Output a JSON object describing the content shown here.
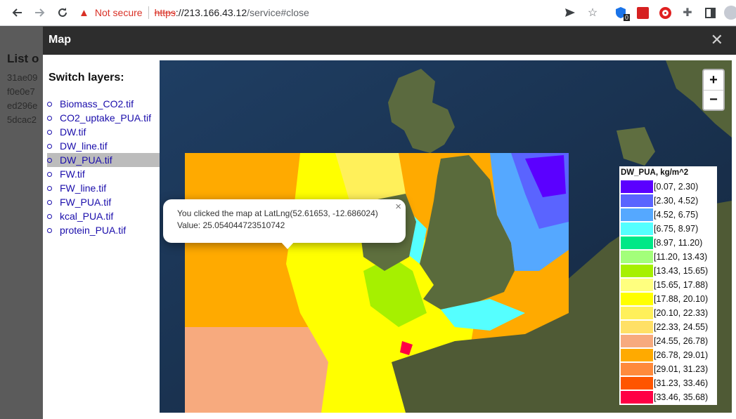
{
  "browser": {
    "warning_text": "Not secure",
    "url_scheme": "https",
    "url_host": "://213.166.43.12",
    "url_path": "/service#close",
    "extension_badge": "0"
  },
  "background_page": {
    "heading": "List o",
    "lines": [
      "31ae09",
      "f0e0e7",
      "ed296e",
      "5dcac2"
    ]
  },
  "modal": {
    "title": "Map",
    "close_glyph": "✕"
  },
  "layers": {
    "title": "Switch layers:",
    "items": [
      "Biomass_CO2.tif",
      "CO2_uptake_PUA.tif",
      "DW.tif",
      "DW_line.tif",
      "DW_PUA.tif",
      "FW.tif",
      "FW_line.tif",
      "FW_PUA.tif",
      "kcal_PUA.tif",
      "protein_PUA.tif"
    ],
    "selected": "DW_PUA.tif"
  },
  "map": {
    "zoom_in": "+",
    "zoom_out": "−",
    "popup_text": "You clicked the map at LatLng(52.61653, -12.686024) Value: 25.054044723510742",
    "popup_close": "×",
    "legend_title": "DW_PUA, kg/m^2",
    "legend": [
      {
        "label": "[0.07, 2.30)",
        "color": "#5b00ff"
      },
      {
        "label": "[2.30, 4.52)",
        "color": "#5a64ff"
      },
      {
        "label": "[4.52, 6.75)",
        "color": "#55a8ff"
      },
      {
        "label": "[6.75, 8.97)",
        "color": "#55ffff"
      },
      {
        "label": "[8.97, 11.20)",
        "color": "#00e887"
      },
      {
        "label": "[11.20, 13.43)",
        "color": "#a3ff7a"
      },
      {
        "label": "[13.43, 15.65)",
        "color": "#a6f000"
      },
      {
        "label": "[15.65, 17.88)",
        "color": "#ffff7f"
      },
      {
        "label": "[17.88, 20.10)",
        "color": "#ffff00"
      },
      {
        "label": "[20.10, 22.33)",
        "color": "#fff05a"
      },
      {
        "label": "[22.33, 24.55)",
        "color": "#ffe066"
      },
      {
        "label": "[24.55, 26.78)",
        "color": "#f7aa7e"
      },
      {
        "label": "[26.78, 29.01)",
        "color": "#ffaa00"
      },
      {
        "label": "[29.01, 31.23)",
        "color": "#ff8a3c"
      },
      {
        "label": "[31.23, 33.46)",
        "color": "#ff5500"
      },
      {
        "label": "[33.46, 35.68)",
        "color": "#ff0045"
      }
    ]
  }
}
